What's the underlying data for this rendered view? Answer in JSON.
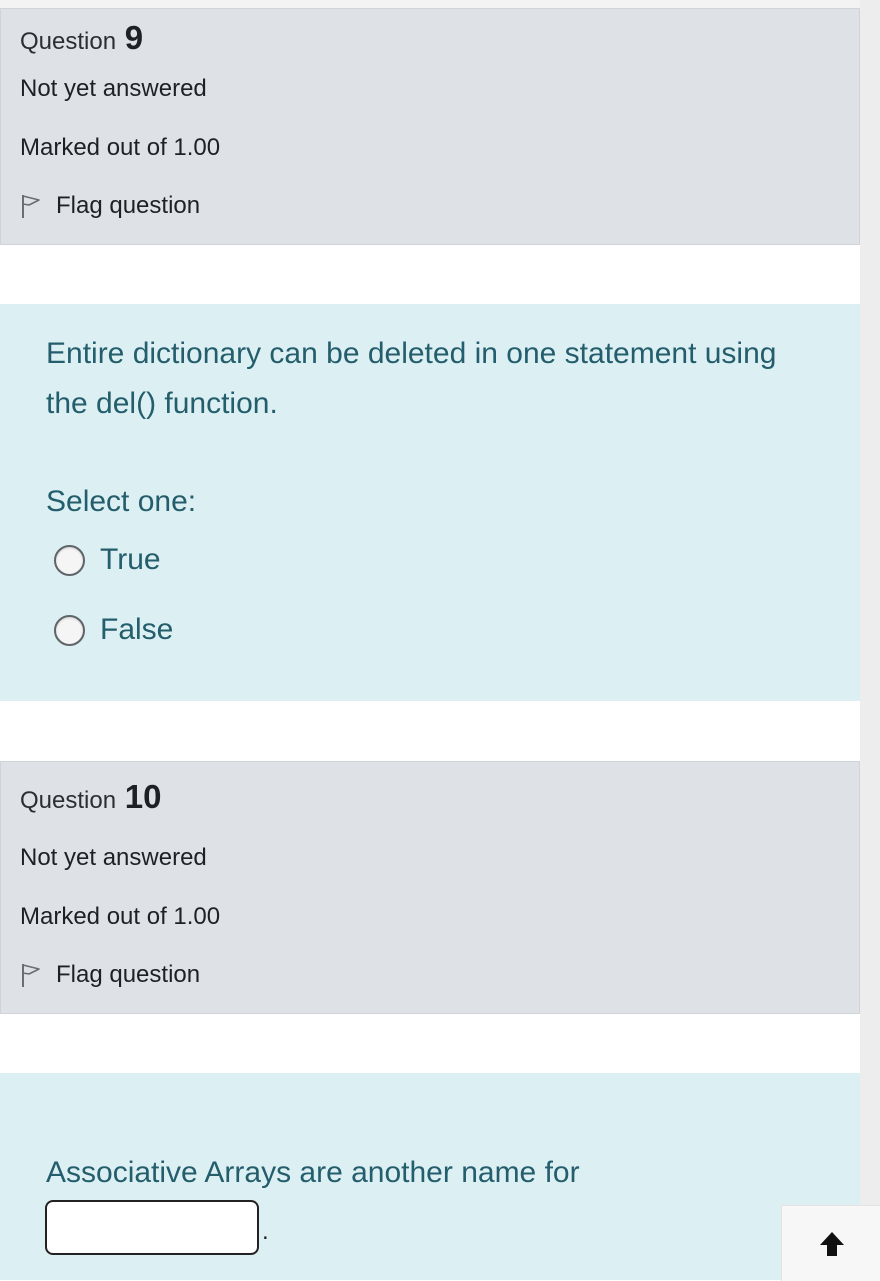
{
  "questions": [
    {
      "label": "Question",
      "number": "9",
      "state": "Not yet answered",
      "grade": "Marked out of 1.00",
      "flag_label": "Flag question",
      "text": "Entire dictionary can be deleted in one statement using the del() function.",
      "prompt": "Select one:",
      "options": [
        "True",
        "False"
      ]
    },
    {
      "label": "Question",
      "number": "10",
      "state": "Not yet answered",
      "grade": "Marked out of 1.00",
      "flag_label": "Flag question",
      "text": "Associative Arrays are another name for",
      "answer_value": "",
      "after_answer": "."
    }
  ],
  "icons": {
    "flag": "flag-outline-icon",
    "back_to_top": "arrow-up-icon"
  },
  "colors": {
    "info_bg": "#dee2e6",
    "content_bg": "#dcf0f4",
    "question_text": "#245d6b"
  }
}
